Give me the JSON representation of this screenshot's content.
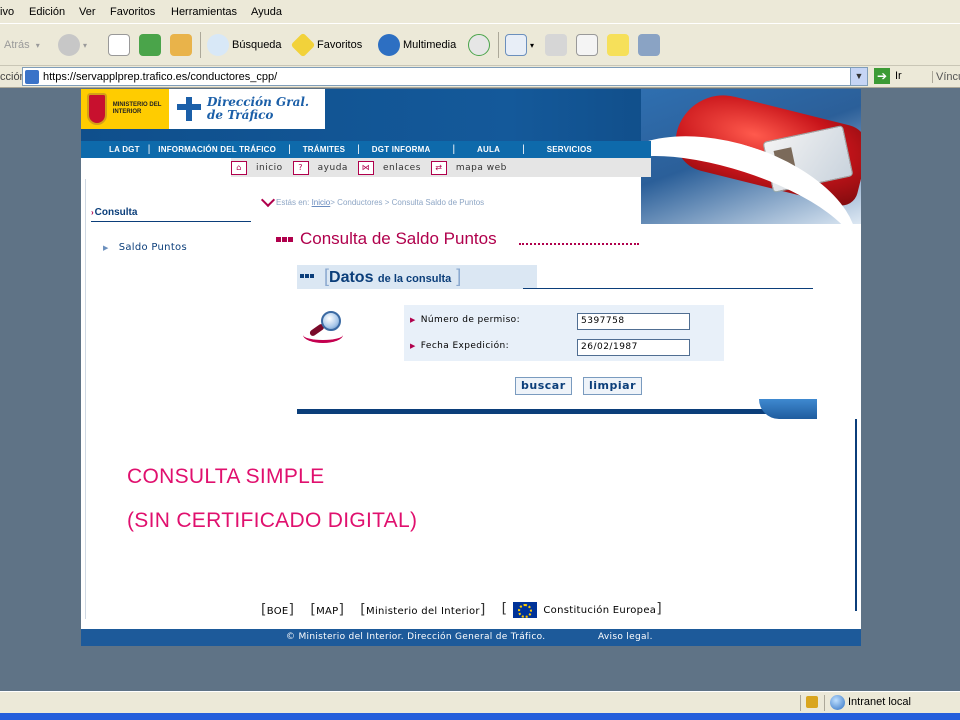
{
  "browser": {
    "menu": [
      "ivo",
      "Edición",
      "Ver",
      "Favoritos",
      "Herramientas",
      "Ayuda"
    ],
    "toolbar": {
      "back_label": "Atrás",
      "search_label": "Búsqueda",
      "favorites_label": "Favoritos",
      "multimedia_label": "Multimedia"
    },
    "address_label": "cción",
    "url": "https://servapplprep.trafico.es/conductores_cpp/",
    "go_label": "Ir",
    "links_label": "Víncul"
  },
  "site": {
    "ministry_text": "MINISTERIO DEL INTERIOR",
    "dgt_line1": "Dirección Gral.",
    "dgt_line2": "de Tráfico",
    "nav": [
      "LA DGT",
      "INFORMACIÓN DEL TRÁFICO",
      "TRÁMITES",
      "DGT INFORMA",
      "AULA",
      "SERVICIOS"
    ],
    "subnav": [
      "inicio",
      "ayuda",
      "enlaces",
      "mapa web"
    ]
  },
  "sidebar": {
    "heading": "Consulta",
    "items": [
      "Saldo Puntos"
    ]
  },
  "breadcrumb": {
    "prefix": "Estás en: ",
    "home": "Inicio",
    "rest": "> Conductores > Consulta Saldo de Puntos"
  },
  "main": {
    "title": "Consulta de Saldo Puntos",
    "section_bold": "Datos",
    "section_rest": "de la consulta",
    "fields": [
      {
        "label": "Número de permiso:",
        "value": "5397758"
      },
      {
        "label": "Fecha Expedición:",
        "value": "26/02/1987"
      }
    ],
    "search_button": "buscar",
    "clear_button": "limpiar"
  },
  "annotation": {
    "line1": "CONSULTA SIMPLE",
    "line2": "(SIN CERTIFICADO DIGITAL)"
  },
  "footer": {
    "links": [
      "BOE",
      "MAP",
      "Ministerio del Interior",
      "Constitución Europea"
    ],
    "copyright": "© Ministerio del Interior. Dirección General de Tráfico.",
    "legal": "Aviso legal."
  },
  "statusbar": {
    "zone": "Intranet local"
  },
  "colors": {
    "brand_blue": "#0b3e7a",
    "accent_magenta": "#b0004c",
    "annotation_pink": "#e0106e"
  }
}
